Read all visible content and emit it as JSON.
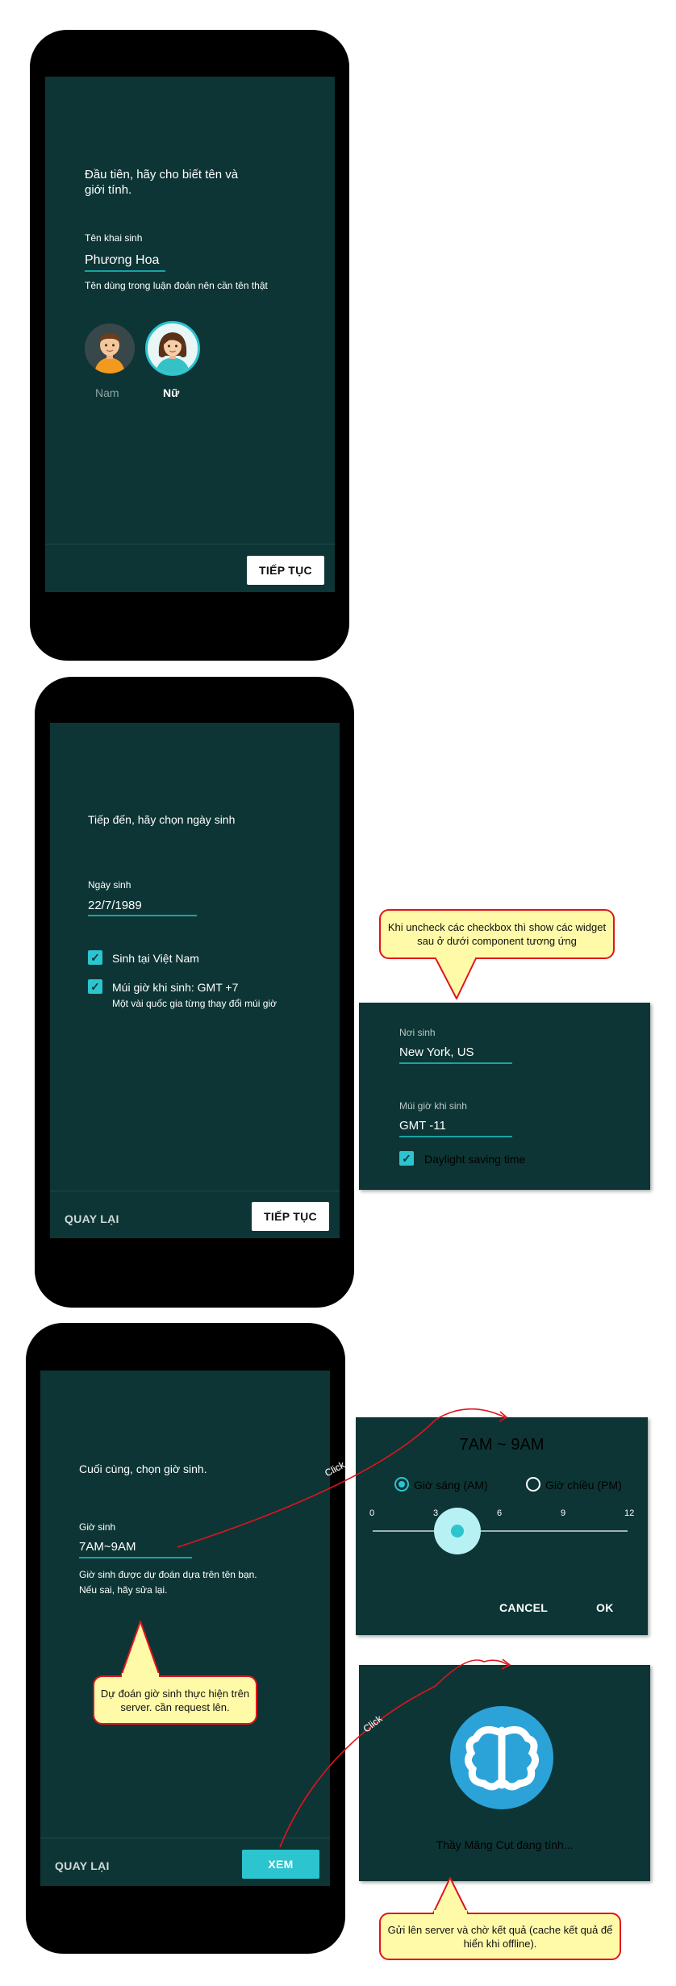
{
  "colors": {
    "screen_bg": "#0d3535",
    "accent": "#2bc4cf",
    "note_bg": "#fffaa8",
    "note_border": "#e0141d",
    "arrow": "#e0141d"
  },
  "screen1": {
    "heading": "Đầu tiên, hãy cho biết tên và giới tính.",
    "name_label": "Tên khai sinh",
    "name_value": "Phương Hoa",
    "name_hint": "Tên dùng trong luận đoán nên cần tên thật",
    "gender_male": "Nam",
    "gender_female": "Nữ",
    "selected_gender": "Nữ",
    "continue_button": "TIẾP TỤC"
  },
  "screen2": {
    "heading": "Tiếp đến, hãy chọn ngày sinh",
    "dob_label": "Ngày sinh",
    "dob_value": "22/7/1989",
    "born_in_vn_label": "Sinh tại Việt Nam",
    "born_in_vn_checked": true,
    "timezone_label": "Múi giờ khi sinh: GMT +7",
    "timezone_checked": true,
    "timezone_hint": "Một vài quốc gia từng thay đổi múi giờ",
    "back_button": "QUAY LẠI",
    "continue_button": "TIẾP TỤC"
  },
  "note_checkbox": "Khi uncheck các checkbox thì show các widget sau ở dưới component tương ứng",
  "widget_birthplace": {
    "place_label": "Nơi sinh",
    "place_value": "New York, US",
    "tz_label": "Múi giờ khi sinh",
    "tz_value": "GMT -11",
    "dst_label": "Daylight saving time",
    "dst_checked": true
  },
  "screen3": {
    "heading": "Cuối cùng, chọn giờ sinh.",
    "time_label": "Giờ sinh",
    "time_value": "7AM~9AM",
    "time_hint_line1": "Giờ sinh được dự đoán dựa trên tên bạn.",
    "time_hint_line2": "Nếu sai, hãy sửa lại.",
    "back_button": "QUAY LẠI",
    "view_button": "XEM"
  },
  "note_server": "Dự đoán giờ sinh thực hiện trên server. cần request lên.",
  "click_label_1": "Click",
  "click_label_2": "Click",
  "time_dialog": {
    "title": "7AM ~ 9AM",
    "am_label": "Giờ sáng (AM)",
    "pm_label": "Giờ chiều (PM)",
    "selected_period": "AM",
    "ticks": [
      "0",
      "3",
      "6",
      "9",
      "12"
    ],
    "slider_value": 4,
    "slider_max": 12,
    "cancel_button": "CANCEL",
    "ok_button": "OK"
  },
  "loading_dialog": {
    "icon": "brain-icon",
    "message": "Thầy Măng Cụt đang tính..."
  },
  "note_offline": "Gửi lên server và chờ kết quả (cache kết quả để hiển khi offline)."
}
